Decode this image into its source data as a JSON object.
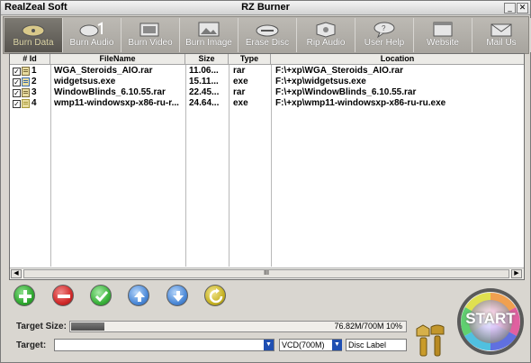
{
  "titlebar": {
    "vendor": "RealZeal Soft",
    "title": "RZ Burner",
    "min_glyph": "_",
    "close_glyph": "✕"
  },
  "toolbar": {
    "items": [
      {
        "label": "Burn Data",
        "icon": "burn-data-icon",
        "active": true
      },
      {
        "label": "Burn Audio",
        "icon": "burn-audio-icon"
      },
      {
        "label": "Burn Video",
        "icon": "burn-video-icon"
      },
      {
        "label": "Burn Image",
        "icon": "burn-image-icon"
      },
      {
        "label": "Erase Disc",
        "icon": "erase-disc-icon"
      },
      {
        "label": "Rip Audio",
        "icon": "rip-audio-icon"
      },
      {
        "label": "User Help",
        "icon": "user-help-icon"
      },
      {
        "label": "Website",
        "icon": "website-icon"
      },
      {
        "label": "Mail Us",
        "icon": "mail-us-icon"
      }
    ]
  },
  "filelist": {
    "columns": [
      "# Id",
      "FileName",
      "Size",
      "Type",
      "Location"
    ],
    "rows": [
      {
        "id": "1",
        "checked": true,
        "name": "WGA_Steroids_AIO.rar",
        "size": "11.06...",
        "type": "rar",
        "location": "F:\\+xp\\WGA_Steroids_AIO.rar"
      },
      {
        "id": "2",
        "checked": true,
        "name": "widgetsus.exe",
        "size": "15.11...",
        "type": "exe",
        "location": "F:\\+xp\\widgetsus.exe"
      },
      {
        "id": "3",
        "checked": true,
        "name": "WindowBlinds_6.10.55.rar",
        "size": "22.45...",
        "type": "rar",
        "location": "F:\\+xp\\WindowBlinds_6.10.55.rar"
      },
      {
        "id": "4",
        "checked": true,
        "name": "wmp11-windowsxp-x86-ru-r...",
        "size": "24.64...",
        "type": "exe",
        "location": "F:\\+xp\\wmp11-windowsxp-x86-ru-ru.exe"
      }
    ],
    "scroll_left": "◀",
    "scroll_right": "▶",
    "scroll_grip": "III"
  },
  "actions": [
    {
      "name": "add-button",
      "icon": "plus-icon",
      "color": "#2fa82f"
    },
    {
      "name": "remove-button",
      "icon": "minus-icon",
      "color": "#d22a2a"
    },
    {
      "name": "check-button",
      "icon": "check-icon",
      "color": "#3bb33b"
    },
    {
      "name": "move-up-button",
      "icon": "arrow-up-icon",
      "color": "#4d8ad8"
    },
    {
      "name": "move-down-button",
      "icon": "arrow-down-icon",
      "color": "#4d8ad8"
    },
    {
      "name": "refresh-button",
      "icon": "refresh-icon",
      "color": "#c7b324"
    }
  ],
  "bottom": {
    "target_size_label": "Target Size:",
    "target_label": "Target:",
    "progress_text": "76.82M/700M  10%",
    "progress_fraction": 0.1,
    "target_value": "",
    "media_select": "VCD(700M)",
    "disc_label": "Disc Label",
    "start_label": "START"
  }
}
